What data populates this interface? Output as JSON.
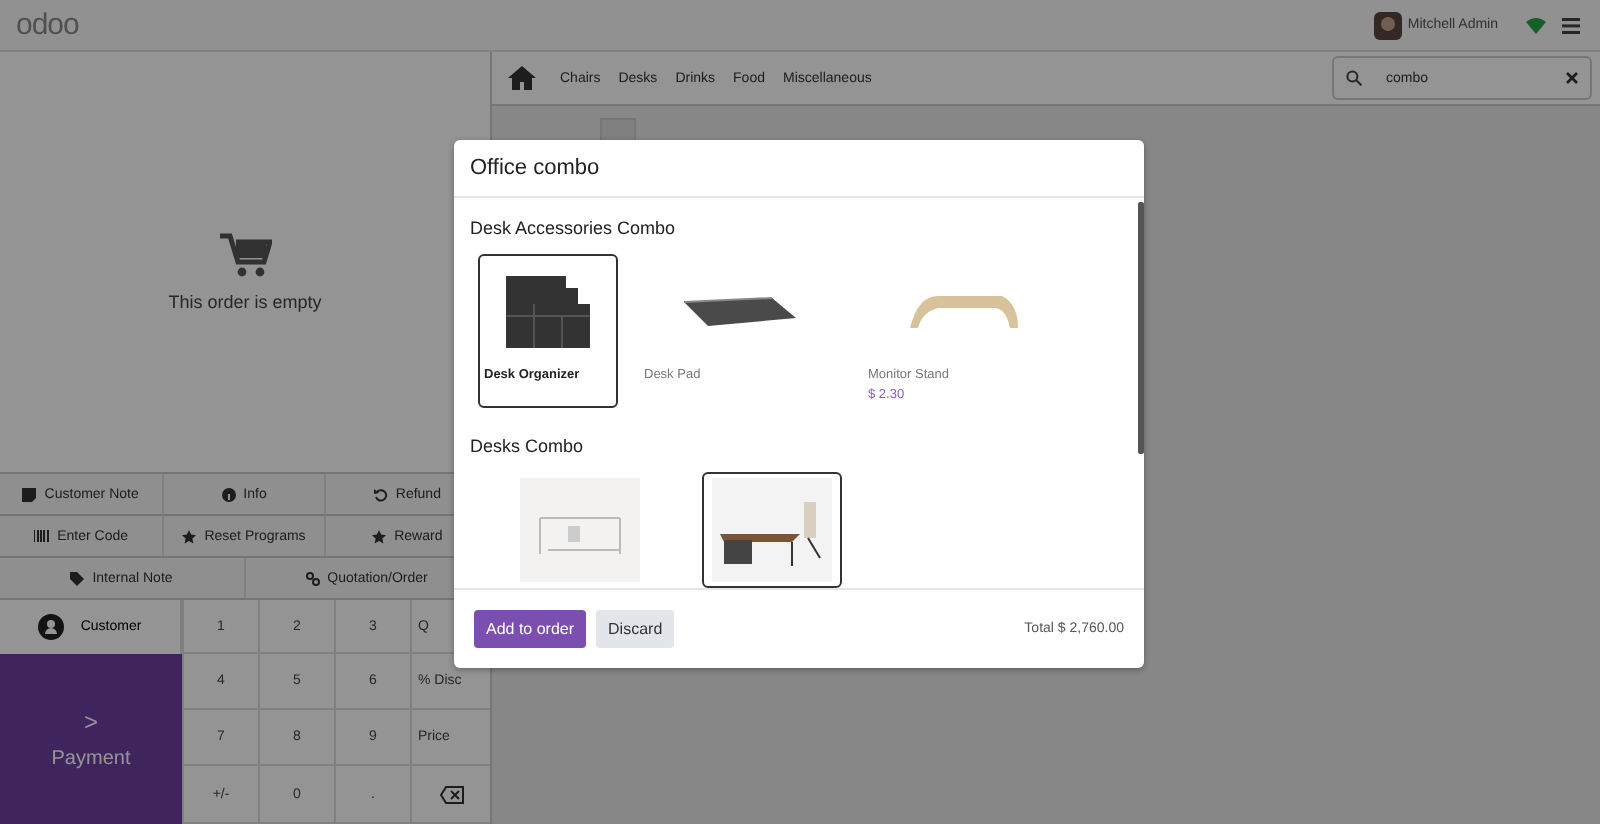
{
  "top_bar": {
    "logo": "odoo",
    "user": "Mitchell Admin"
  },
  "order": {
    "empty_message": "This order is empty"
  },
  "action_rows": [
    [
      {
        "label": "Customer Note",
        "kind": "note"
      },
      {
        "label": "Info",
        "kind": "info"
      },
      {
        "label": "Refund",
        "kind": "undo"
      }
    ],
    [
      {
        "label": "Enter Code",
        "kind": "barcode"
      },
      {
        "label": "Reset Programs",
        "kind": "star"
      },
      {
        "label": "Reward",
        "kind": "star"
      }
    ],
    [
      {
        "label": "Internal Note",
        "kind": "tag"
      },
      {
        "label": "Quotation/Order",
        "kind": "link"
      }
    ]
  ],
  "customer_button": "Customer",
  "payment_button": {
    "arrow": ">",
    "label": "Payment"
  },
  "numpad": [
    {
      "kind": "text",
      "label": "1"
    },
    {
      "kind": "text",
      "label": "2"
    },
    {
      "kind": "text",
      "label": "3"
    },
    {
      "kind": "text",
      "label": "Q"
    },
    {
      "kind": "text",
      "label": "4"
    },
    {
      "kind": "text",
      "label": "5"
    },
    {
      "kind": "text",
      "label": "6"
    },
    {
      "kind": "text",
      "label": "% Disc"
    },
    {
      "kind": "text",
      "label": "7"
    },
    {
      "kind": "text",
      "label": "8"
    },
    {
      "kind": "text",
      "label": "9"
    },
    {
      "kind": "text",
      "label": "Price"
    },
    {
      "kind": "text",
      "label": "+/-"
    },
    {
      "kind": "text",
      "label": "0"
    },
    {
      "kind": "text",
      "label": "."
    },
    {
      "kind": "backspace"
    }
  ],
  "categories": [
    "Chairs",
    "Desks",
    "Drinks",
    "Food",
    "Miscellaneous"
  ],
  "search": {
    "value": "combo"
  },
  "dialog": {
    "title": "Office combo",
    "sections": [
      {
        "title": "Desk Accessories Combo",
        "products": [
          {
            "kind": "organizer",
            "name": "Desk Organizer",
            "selected": true
          },
          {
            "kind": "pad",
            "name": "Desk Pad",
            "selected": false
          },
          {
            "kind": "stand",
            "name": "Monitor Stand",
            "price": "$ 2.30",
            "selected": false
          }
        ]
      },
      {
        "title": "Desks Combo",
        "products": [
          {
            "kind": "frame",
            "selected": false
          },
          {
            "kind": "desk",
            "selected": true
          }
        ]
      }
    ],
    "buttons": [
      {
        "kind": "primary",
        "label": "Add to order"
      },
      {
        "kind": "secondary",
        "label": "Discard"
      }
    ],
    "total": "Total $ 2,760.00"
  }
}
